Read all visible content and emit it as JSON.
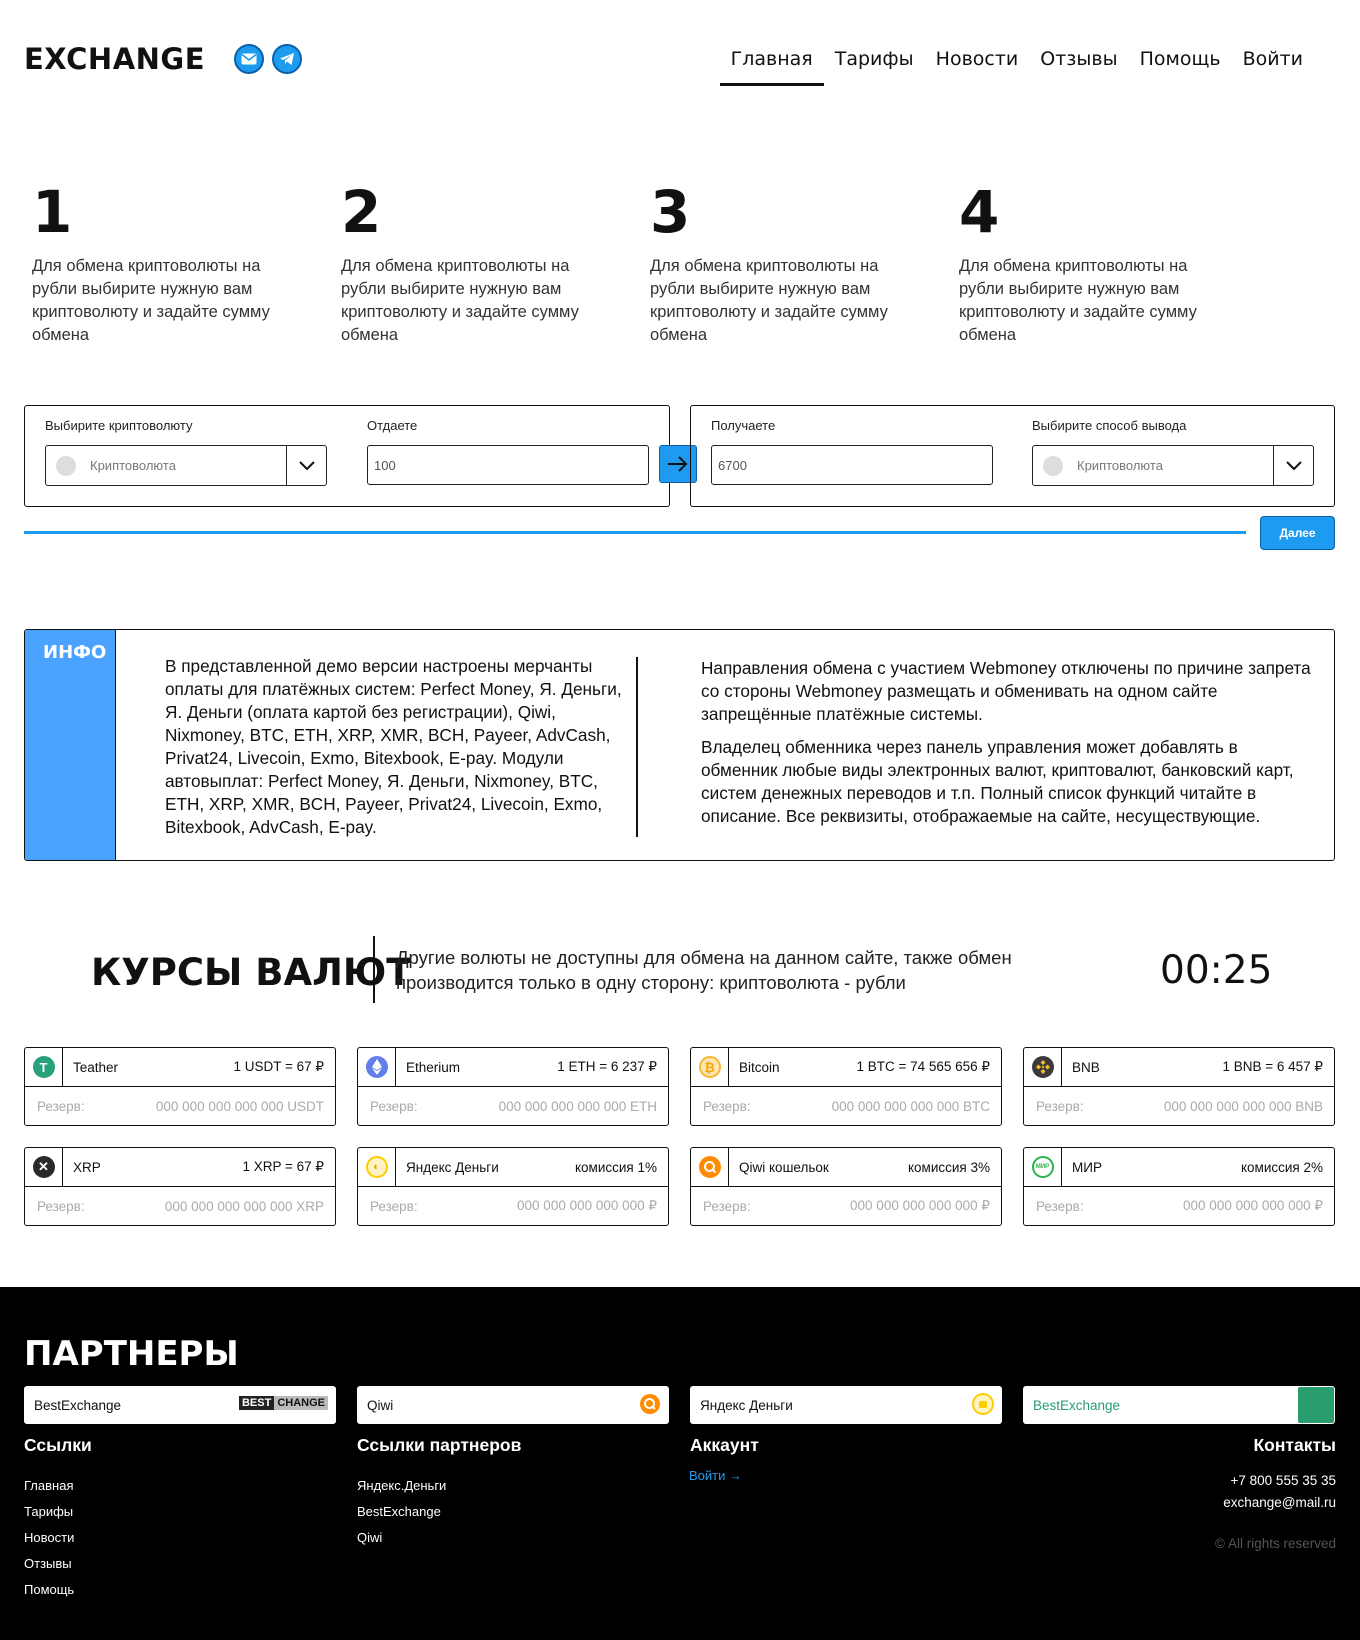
{
  "header": {
    "logo": "EXCHANGE",
    "social": [
      {
        "icon": "mail-icon"
      },
      {
        "icon": "telegram-icon"
      }
    ],
    "nav": [
      "Главная",
      "Тарифы",
      "Новости",
      "Отзывы",
      "Помощь",
      "Войти"
    ],
    "active_nav": "Главная"
  },
  "steps": [
    {
      "num": "1",
      "text": "Для обмена криптоволюты на рубли выбирите нужную вам криптоволюту и задайте сумму обмена"
    },
    {
      "num": "2",
      "text": "Для обмена криптоволюты на рубли выбирите нужную вам криптоволюту и задайте сумму обмена"
    },
    {
      "num": "3",
      "text": "Для обмена криптоволюты на рубли выбирите нужную вам криптоволюту и задайте сумму обмена"
    },
    {
      "num": "4",
      "text": "Для обмена криптоволюты на рубли выбирите нужную вам криптоволюту и задайте сумму обмена"
    }
  ],
  "form": {
    "crypto_label": "Выбирите криптоволюту",
    "crypto_placeholder": "Криптоволюта",
    "give_label": "Отдаете",
    "give_value": "100",
    "receive_label": "Получаете",
    "receive_value": "6700",
    "method_label": "Выбирите способ вывода",
    "method_placeholder": "Криптоволюта",
    "next_label": "Далее",
    "accent": "#1d9bf0"
  },
  "info": {
    "tag": "ИНФО",
    "left": "В представленной демо версии настроены мерчанты оплаты для платёжных систем: Perfect Money, Я. Деньги, Я. Деньги (оплата картой без регистрации), Qiwi, Nixmoney, BTC, ETH, XRP, XMR, BCH, Payeer, AdvCash, Privat24, Livecoin, Exmo, Bitexbook, E-pay. Модули автовыплат: Perfect Money, Я. Деньги, Nixmoney, BTC, ETH, XRP, XMR, BCH, Payeer, Privat24, Livecoin, Exmo, Bitexbook, AdvCash, E-pay.",
    "right_p1": "Направления обмена с участием Webmoney отключены по причине запрета со стороны Webmoney размещать и обменивать на одном сайте запрещённые платёжные системы.",
    "right_p2": "Владелец обменника через панель управления может добавлять в обменник любые виды электронных валют, криптовалют, банковский карт, систем денежных переводов и т.п. Полный список функций читайте в описание. Все реквизиты, отображаемые на сайте, несуществующие."
  },
  "rates": {
    "title": "КУРСЫ ВАЛЮТ",
    "description": "Другие волюты не доступны для обмена на данном сайте, также обмен производится только в одну сторону: криптоволюта - рубли",
    "timer": "00:25",
    "reserve_label": "Резерв:",
    "cards": [
      {
        "name": "Teather",
        "rate": "1 USDT = 67 ₽",
        "reserve": "000 000 000 000 000 USDT",
        "icon": "tether-icon",
        "color": "#26a17b"
      },
      {
        "name": "Etherium",
        "rate": "1 ETH = 6 237 ₽",
        "reserve": "000 000 000 000 000 ETH",
        "icon": "ethereum-icon",
        "color": "#627eea"
      },
      {
        "name": "Bitcoin",
        "rate": "1 BTC = 74 565 656 ₽",
        "reserve": "000 000 000 000 000 BTC",
        "icon": "bitcoin-icon",
        "color": "#f7b733"
      },
      {
        "name": "BNB",
        "rate": "1 BNB = 6 457 ₽",
        "reserve": "000 000 000 000 000 BNB",
        "icon": "bnb-icon",
        "color": "#3a3a3a"
      },
      {
        "name": "XRP",
        "rate": "1 XRP = 67 ₽",
        "reserve": "000 000 000 000 000 XRP",
        "icon": "xrp-icon",
        "color": "#2a2a2a"
      },
      {
        "name": "Яндекс Деньги",
        "rate": "комиссия 1%",
        "reserve": "000 000 000 000 000 ₽",
        "icon": "yandex-money-icon",
        "color": "#ffcc00"
      },
      {
        "name": "Qiwi кошельок",
        "rate": "комиссия 3%",
        "reserve": "000 000 000 000 000 ₽",
        "icon": "qiwi-icon",
        "color": "#ff8c00"
      },
      {
        "name": "МИР",
        "rate": "комиссия 2%",
        "reserve": "000 000 000 000 000 ₽",
        "icon": "mir-icon",
        "color": "#2fb24c"
      }
    ]
  },
  "footer": {
    "partners_title": "ПАРТНЕРЫ",
    "partners": [
      {
        "name": "BestExchange",
        "badge_a": "BEST",
        "badge_b": "CHANGE"
      },
      {
        "name": "Qiwi"
      },
      {
        "name": "Яндекс Деньги"
      },
      {
        "name": "BestExchange"
      }
    ],
    "links_title": "Ссылки",
    "links": [
      "Главная",
      "Тарифы",
      "Новости",
      "Отзывы",
      "Помощь"
    ],
    "partner_links_title": "Ссылки партнеров",
    "partner_links": [
      "Яндекс.Деньги",
      "BestExchange",
      "Qiwi"
    ],
    "account_title": "Аккаунт",
    "account_login": "Войти →",
    "contacts_title": "Контакты",
    "phone": "+7 800 555 35 35",
    "email": "exchange@mail.ru",
    "rights": "© All rights reserved"
  }
}
